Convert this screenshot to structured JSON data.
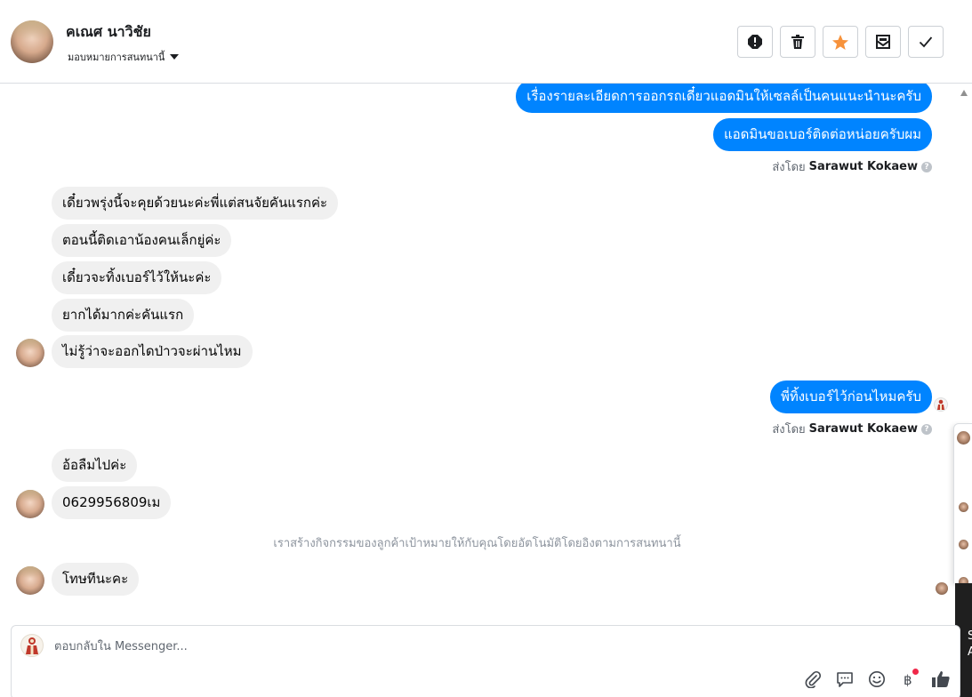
{
  "header": {
    "contact_name": "คเณศ นาวิชัย",
    "assign_label": "มอบหมายการสนทนานี้",
    "actions": [
      "spam-button",
      "delete-button",
      "star-button",
      "mark-unread-button",
      "done-button"
    ]
  },
  "conversation": {
    "messages": [
      {
        "direction": "out",
        "text": "เรื่องรายละเอียดการออกรถเดี๋ยวแอดมินให้เซลล์เป็นคนแนะนำนะครับ"
      },
      {
        "direction": "out",
        "text": "แอดมินขอเบอร์ติดต่อหน่อยครับผม"
      },
      {
        "direction": "in",
        "text": "เดี๋ยวพรุ่งนี้จะคุยด้วยนะค่ะพี่แต่สนจัยคันแรกค่ะ"
      },
      {
        "direction": "in",
        "text": "ตอนนี้ติดเอาน้องคนเล็กยู่ค่ะ"
      },
      {
        "direction": "in",
        "text": "เดี๋ยวจะทิ้งเบอร์ไว้ให้นะค่ะ"
      },
      {
        "direction": "in",
        "text": "ยากได้มากค่ะคันแรก"
      },
      {
        "direction": "in",
        "text": "ไม่รู้ว่าจะออกไดป่าวจะผ่านไหม"
      },
      {
        "direction": "out",
        "text": "พี่ทิ้งเบอร์ไว้ก่อนไหมครับ"
      },
      {
        "direction": "in",
        "text": "อ้อลืมไปค่ะ"
      },
      {
        "direction": "in",
        "text": "0629956809เม"
      },
      {
        "direction": "in",
        "text": "โทษทีนะคะ"
      }
    ],
    "sent_by_prefix": "ส่งโดย",
    "sent_by_name": "Sarawut Kokaew",
    "help_glyph": "?",
    "system_note": "เราสร้างกิจกรรมของลูกค้าเป้าหมายให้กับคุณโดยอัตโนมัติโดยอิงตามการสนทนานี้"
  },
  "composer": {
    "placeholder": "ตอบกลับใน Messenger...",
    "tools": [
      "paperclip-icon",
      "quick-reply-icon",
      "emoji-icon",
      "baht-payment-icon",
      "like-icon"
    ]
  },
  "edge_panel": {
    "line1": "S",
    "line2": "A"
  },
  "colors": {
    "outgoing_bubble": "#0084ff",
    "incoming_bubble": "#f0f0f0",
    "star": "#f7923b",
    "notification": "#f02849"
  }
}
